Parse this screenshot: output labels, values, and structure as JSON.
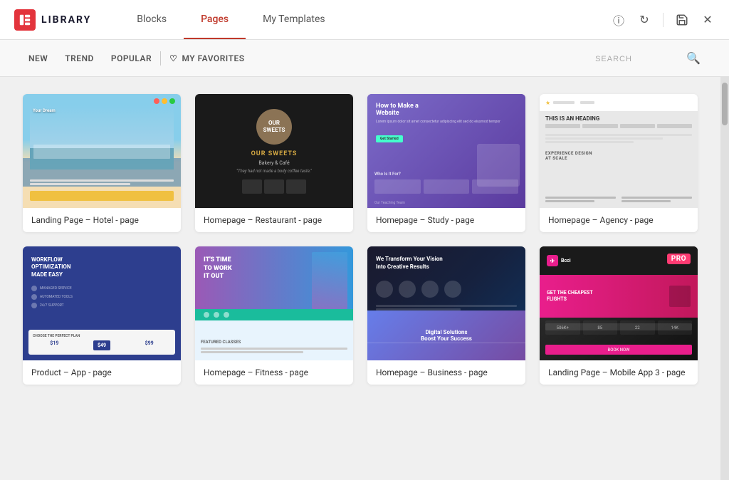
{
  "app": {
    "logo_text": "LIBRARY",
    "logo_icon": "E"
  },
  "header": {
    "tabs": [
      {
        "id": "blocks",
        "label": "Blocks",
        "active": false
      },
      {
        "id": "pages",
        "label": "Pages",
        "active": true
      },
      {
        "id": "my-templates",
        "label": "My Templates",
        "active": false
      }
    ],
    "actions": [
      {
        "id": "info",
        "icon": "ℹ",
        "label": "info-icon"
      },
      {
        "id": "refresh",
        "icon": "↻",
        "label": "refresh-icon"
      },
      {
        "id": "save",
        "icon": "💾",
        "label": "save-icon"
      },
      {
        "id": "close",
        "icon": "✕",
        "label": "close-icon"
      }
    ]
  },
  "filter": {
    "tabs": [
      {
        "id": "new",
        "label": "NEW",
        "active": false
      },
      {
        "id": "trend",
        "label": "TREND",
        "active": false
      },
      {
        "id": "popular",
        "label": "POPULAR",
        "active": false
      }
    ],
    "favorites_label": "MY FAVORITES",
    "search_placeholder": "SEARCH"
  },
  "templates": [
    {
      "id": "hotel",
      "label": "Landing Page – Hotel - page",
      "type": "hotel",
      "pro": false
    },
    {
      "id": "restaurant",
      "label": "Homepage – Restaurant - page",
      "type": "restaurant",
      "pro": false
    },
    {
      "id": "study",
      "label": "Homepage – Study - page",
      "type": "study",
      "pro": false
    },
    {
      "id": "agency",
      "label": "Homepage – Agency - page",
      "type": "agency",
      "pro": false
    },
    {
      "id": "app",
      "label": "Product – App - page",
      "type": "app",
      "pro": false
    },
    {
      "id": "fitness",
      "label": "Homepage – Fitness - page",
      "type": "fitness",
      "pro": false
    },
    {
      "id": "business",
      "label": "Homepage – Business - page",
      "type": "business",
      "pro": false
    },
    {
      "id": "mobile",
      "label": "Landing Page – Mobile App 3 - page",
      "type": "mobile",
      "pro": true
    }
  ]
}
